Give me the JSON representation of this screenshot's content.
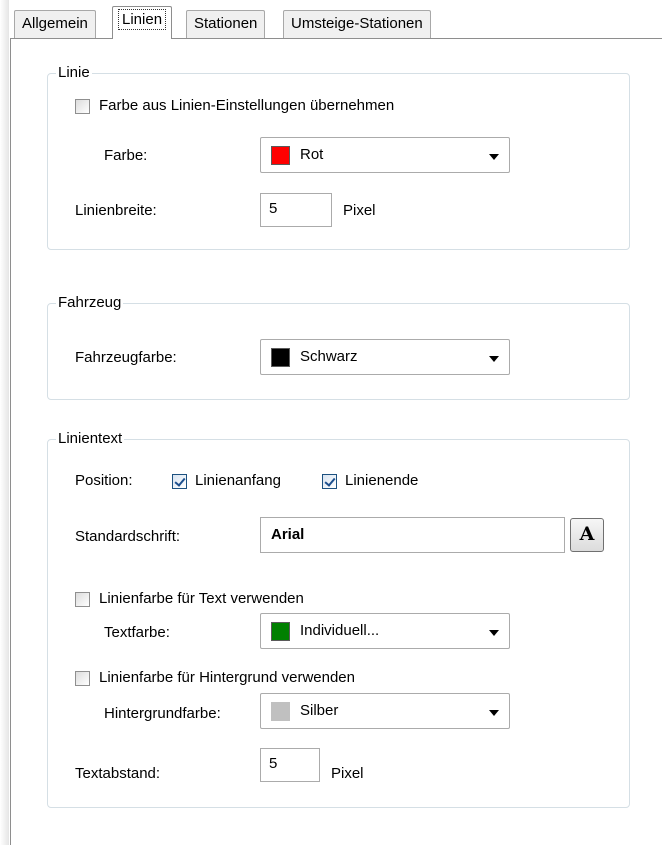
{
  "tabs": [
    {
      "label": "Allgemein",
      "active": false
    },
    {
      "label": "Linien",
      "active": true
    },
    {
      "label": "Stationen",
      "active": false
    },
    {
      "label": "Umsteige-Stationen",
      "active": false
    }
  ],
  "linie": {
    "legend": "Linie",
    "use_line_color_label": "Farbe aus Linien-Einstellungen übernehmen",
    "use_line_color_checked": false,
    "color_label": "Farbe:",
    "color_value": "Rot",
    "color_swatch": "#ff0000",
    "width_label": "Linienbreite:",
    "width_value": "5",
    "width_unit": "Pixel"
  },
  "fahrzeug": {
    "legend": "Fahrzeug",
    "color_label": "Fahrzeugfarbe:",
    "color_value": "Schwarz",
    "color_swatch": "#000000"
  },
  "linientext": {
    "legend": "Linientext",
    "position_label": "Position:",
    "pos_start_label": "Linienanfang",
    "pos_start_checked": true,
    "pos_end_label": "Linienende",
    "pos_end_checked": true,
    "font_label": "Standardschrift:",
    "font_value": "Arial",
    "font_button_label": "A",
    "text_line_color_label": "Linienfarbe für Text verwenden",
    "text_line_color_checked": false,
    "text_color_label": "Textfarbe:",
    "text_color_value": "Individuell...",
    "text_color_swatch": "#008000",
    "bg_line_color_label": "Linienfarbe für Hintergrund verwenden",
    "bg_line_color_checked": false,
    "bg_color_label": "Hintergrundfarbe:",
    "bg_color_value": "Silber",
    "bg_color_swatch": "#c0c0c0",
    "spacing_label": "Textabstand:",
    "spacing_value": "5",
    "spacing_unit": "Pixel"
  }
}
